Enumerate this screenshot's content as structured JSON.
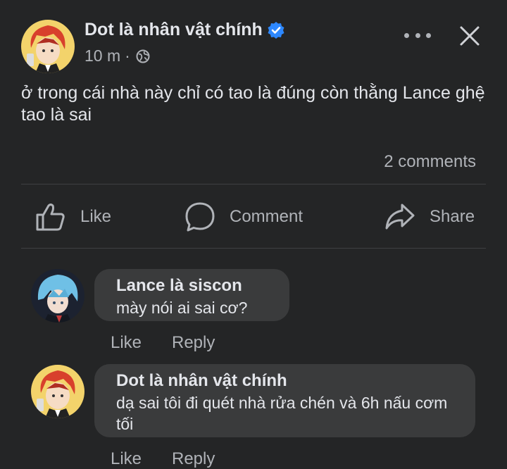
{
  "post": {
    "author": "Dot là nhân vật chính",
    "time": "10 m",
    "separator": "·",
    "text": "ở trong cái nhà này chỉ có tao là đúng còn thằng Lance ghệ tao là sai",
    "comments_count": "2 comments"
  },
  "icons": {
    "verified": "verified-badge-icon",
    "privacy": "globe-icon",
    "more": "more-options-icon",
    "close": "close-icon",
    "like": "thumbs-up-icon",
    "comment": "comment-bubble-icon",
    "share": "share-arrow-icon"
  },
  "actions": {
    "like": "Like",
    "comment": "Comment",
    "share": "Share"
  },
  "comments": [
    {
      "author": "Lance là siscon",
      "text": "mày nói ai sai cơ?",
      "like": "Like",
      "reply": "Reply"
    },
    {
      "author": "Dot là nhân vật chính",
      "text": "dạ sai tôi đi quét nhà rửa chén và 6h nấu cơm tối",
      "like": "Like",
      "reply": "Reply"
    }
  ],
  "colors": {
    "background": "#242526",
    "bubble": "#3a3b3c",
    "primary_text": "#e4e6eb",
    "secondary_text": "#b0b3b8",
    "verified": "#2d88ff"
  }
}
